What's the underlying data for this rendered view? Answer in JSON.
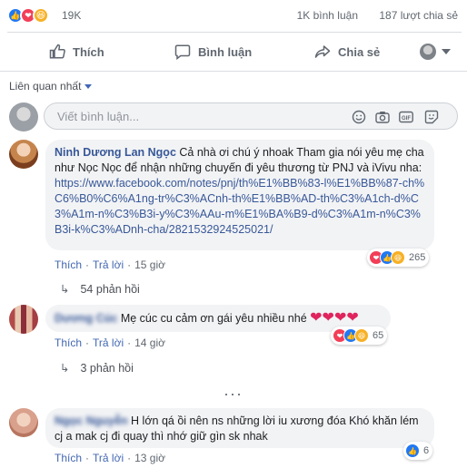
{
  "post_stats": {
    "reaction_count": "19K",
    "comments_count": "1K bình luận",
    "shares_count": "187 lượt chia sẻ"
  },
  "actions": {
    "like_label": "Thích",
    "comment_label": "Bình luận",
    "share_label": "Chia sẻ"
  },
  "sort": {
    "label": "Liên quan nhất"
  },
  "composer": {
    "placeholder": "Viết bình luận..."
  },
  "comments": [
    {
      "author": "Ninh Dương Lan Ngọc",
      "text": "Cả nhà ơi chú ý nhoak Tham gia nói yêu mẹ cha như Nọc Nọc để nhận những chuyến đi yêu thương từ PNJ và iVivu nha:",
      "link": "https://www.facebook.com/notes/pnj/th%E1%BB%83-l%E1%BB%87-ch%C6%B0%C6%A1ng-tr%C3%ACnh-th%E1%BB%AD-th%C3%A1ch-d%C3%A1m-n%C3%B3i-y%C3%AAu-m%E1%BA%B9-d%C3%A1m-n%C3%B3i-k%C3%ADnh-cha/2821532924525021/",
      "like_action": "Thích",
      "reply_action": "Trả lời",
      "time": "15 giờ",
      "reaction_count": "265",
      "replies": "54 phản hồi"
    },
    {
      "author": "Dương Cúc",
      "text": "Mẹ cúc cu cảm ơn gái yêu nhiều nhé",
      "like_action": "Thích",
      "reply_action": "Trả lời",
      "time": "14 giờ",
      "reaction_count": "65",
      "replies": "3 phản hồi"
    },
    {
      "author": "Ngọc Nguyễn",
      "text": "H lớn qá ồi nên ns những lời iu xương đóa Khó khăn lém cj a mak cj đi quay thì nhớ giữ gìn sk nhak",
      "like_action": "Thích",
      "reply_action": "Trả lời",
      "time": "13 giờ",
      "reaction_count": "6"
    }
  ],
  "colors": {
    "accent": "#4267b2",
    "link": "#385898",
    "like": "#2078f4",
    "love": "#f33e58",
    "haha": "#f7b125",
    "bubble": "#f2f3f5"
  }
}
